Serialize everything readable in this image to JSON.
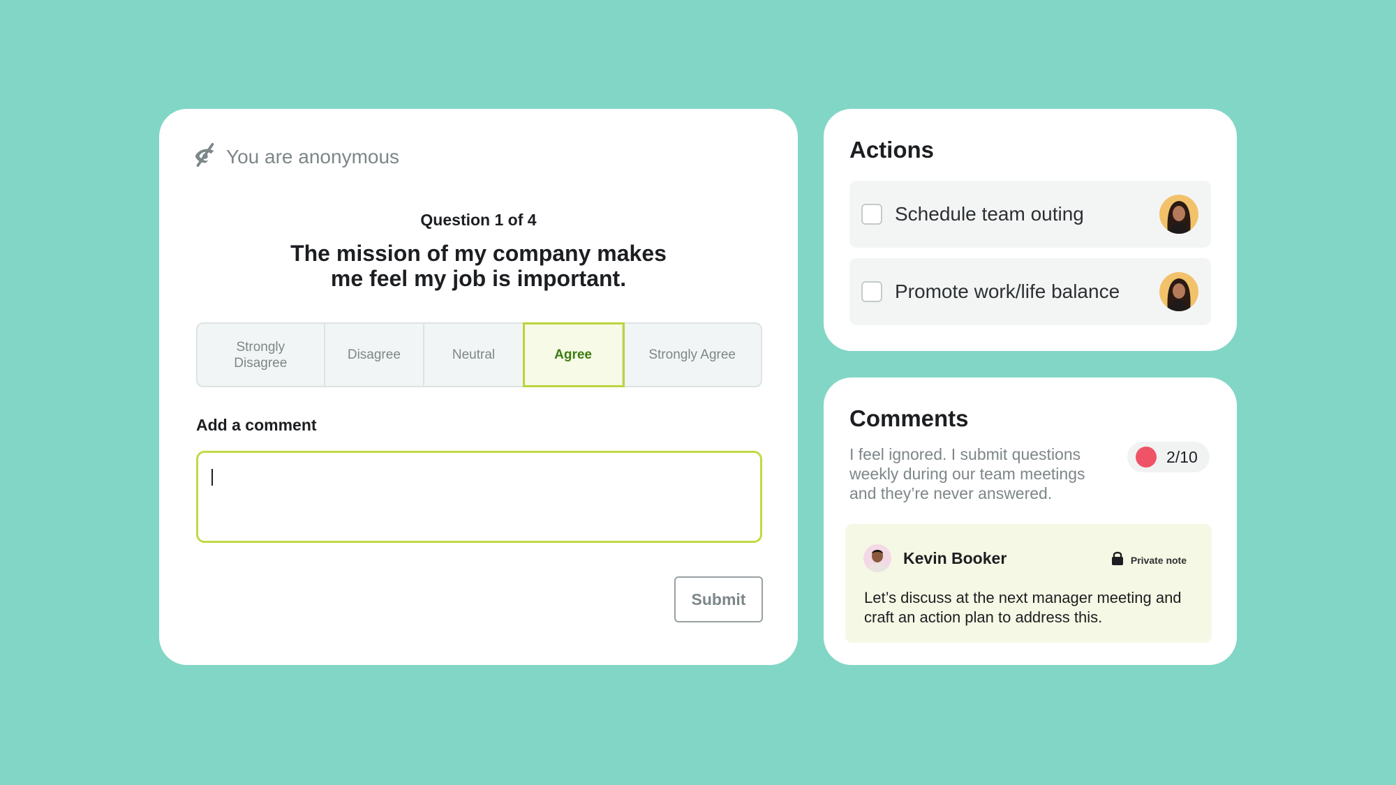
{
  "survey": {
    "anonymous_label": "You are anonymous",
    "question_counter": "Question 1 of 4",
    "question_text": "The mission of my company makes me feel my job is important.",
    "scale_options": [
      "Strongly Disagree",
      "Disagree",
      "Neutral",
      "Agree",
      "Strongly Agree"
    ],
    "selected_option": "Agree",
    "comment_label": "Add a comment",
    "comment_value": "",
    "submit_label": "Submit"
  },
  "actions": {
    "title": "Actions",
    "items": [
      {
        "label": "Schedule team outing",
        "checked": false
      },
      {
        "label": "Promote work/life balance",
        "checked": false
      }
    ]
  },
  "comments": {
    "title": "Comments",
    "comment_text": "I feel ignored. I submit questions weekly during our team meetings and they’re never answered.",
    "score": "2/10",
    "score_color": "#ef5466",
    "note": {
      "author": "Kevin Booker",
      "visibility": "Private note",
      "body": "Let’s discuss at the next manager meeting and craft an action plan to address this."
    }
  },
  "colors": {
    "background": "#82d6c5",
    "accent": "#bcd43c",
    "selected_text": "#3d7c12"
  }
}
